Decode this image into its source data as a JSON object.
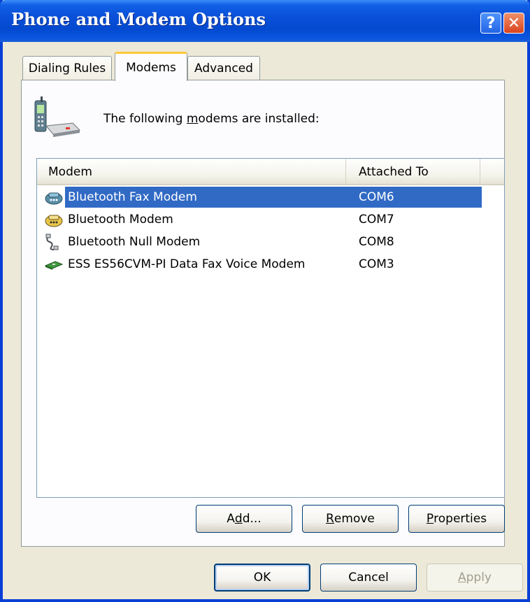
{
  "window": {
    "title": "Phone and Modem Options",
    "help_glyph": "?",
    "close_glyph": "✕"
  },
  "tabs": [
    {
      "label": "Dialing Rules",
      "selected": false
    },
    {
      "label": "Modems",
      "selected": true
    },
    {
      "label": "Advanced",
      "selected": false
    }
  ],
  "panel": {
    "installed_label_pre": "The following ",
    "installed_label_accel": "m",
    "installed_label_post": "odems are  installed:"
  },
  "listview": {
    "columns": [
      "Modem",
      "Attached To"
    ],
    "rows": [
      {
        "name": "Bluetooth Fax Modem",
        "port": "COM6",
        "icon": "fax-modem-icon",
        "selected": true
      },
      {
        "name": "Bluetooth Modem",
        "port": "COM7",
        "icon": "modem-icon",
        "selected": false
      },
      {
        "name": "Bluetooth Null Modem",
        "port": "COM8",
        "icon": "null-modem-icon",
        "selected": false
      },
      {
        "name": "ESS ES56CVM-PI Data Fax Voice Modem",
        "port": "COM3",
        "icon": "modem-card-icon",
        "selected": false
      }
    ]
  },
  "buttons": {
    "add_pre": "A",
    "add_accel": "d",
    "add_post": "d...",
    "remove_accel": "R",
    "remove_post": "emove",
    "properties_accel": "P",
    "properties_post": "roperties",
    "ok": "OK",
    "cancel": "Cancel",
    "apply_accel": "A",
    "apply_post": "pply"
  },
  "colors": {
    "titlebar": "#0a50d8",
    "selection": "#316ac5",
    "dialog_bg": "#ece9d8"
  }
}
